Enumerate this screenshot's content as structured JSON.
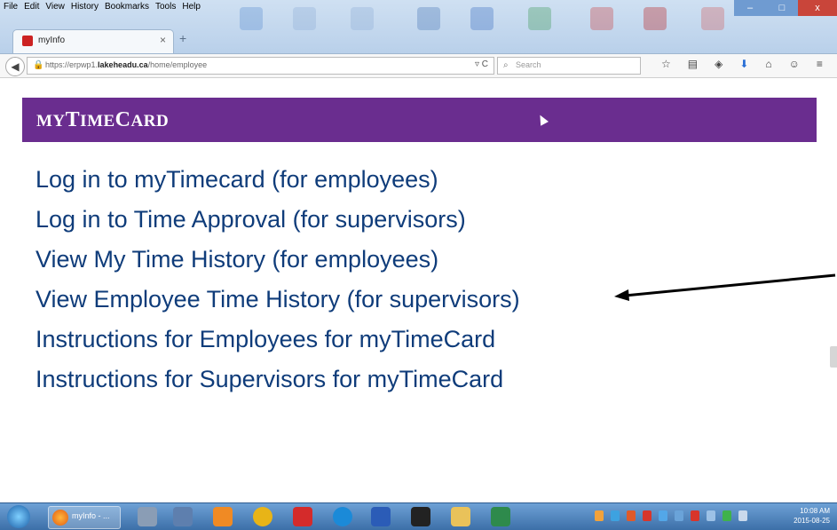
{
  "browser": {
    "menu": [
      "File",
      "Edit",
      "View",
      "History",
      "Bookmarks",
      "Tools",
      "Help"
    ],
    "tab_title": "myInfo",
    "tab_close": "×",
    "new_tab": "+",
    "url_prefix": "https://erpwp1.",
    "url_domain": "lakeheadu.ca",
    "url_path": "/home/employee",
    "search_placeholder": "Search",
    "toolbar_icons": [
      "star-icon",
      "reading-list-icon",
      "pocket-icon",
      "download-icon",
      "home-icon",
      "chat-icon",
      "menu-icon"
    ],
    "win_controls": {
      "minimize": "–",
      "maximize": "□",
      "close": "x"
    }
  },
  "page": {
    "brand": {
      "m": "MY",
      "t": "T",
      "ime": "IME",
      "c": "C",
      "ard": "ARD"
    },
    "header_color": "#6a2d8f",
    "links": [
      "Log in to myTimecard (for employees)",
      "Log in to Time Approval (for supervisors)",
      "View My Time History (for employees)",
      "View Employee Time History (for supervisors)",
      "Instructions for Employees for myTimeCard",
      "Instructions for Supervisors for myTimeCard"
    ]
  },
  "taskbar": {
    "active_app_label": "myInfo - ...",
    "clock_time": "10:08 AM",
    "clock_date": "2015-08-25"
  }
}
